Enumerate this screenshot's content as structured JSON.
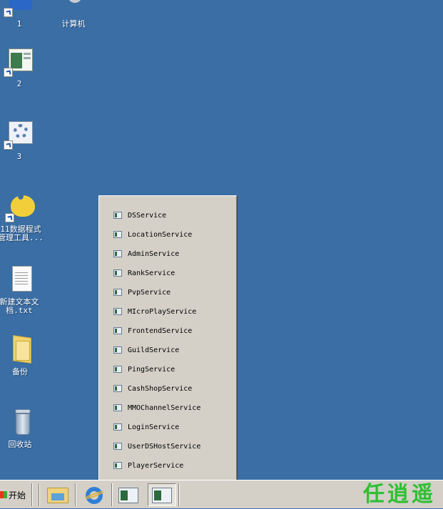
{
  "desktop": {
    "icons": [
      {
        "name": "shortcut-1",
        "label": "1"
      },
      {
        "name": "computer",
        "label": "计算机"
      },
      {
        "name": "shortcut-2",
        "label": "2"
      },
      {
        "name": "shortcut-3",
        "label": "3"
      },
      {
        "name": "db-tool",
        "label": "11数据程式\n管理工具..."
      },
      {
        "name": "new-text-file",
        "label": "新建文本文\n档.txt"
      },
      {
        "name": "backup-folder",
        "label": "备份"
      },
      {
        "name": "recycle-bin",
        "label": "回收站"
      }
    ]
  },
  "menu": {
    "items": [
      "DSService",
      "LocationService",
      "AdminService",
      "RankService",
      "PvpService",
      "MIcroPlayService",
      "FrontendService",
      "GuildService",
      "PingService",
      "CashShopService",
      "MMOChannelService",
      "LoginService",
      "UserDSHostService",
      "PlayerService"
    ]
  },
  "taskbar": {
    "start_label": "开始",
    "watermark": "任逍遥"
  },
  "colors": {
    "desktop": "#3a6ea5",
    "taskbar": "#d4d0c8",
    "watermark": "#2fbf34"
  }
}
